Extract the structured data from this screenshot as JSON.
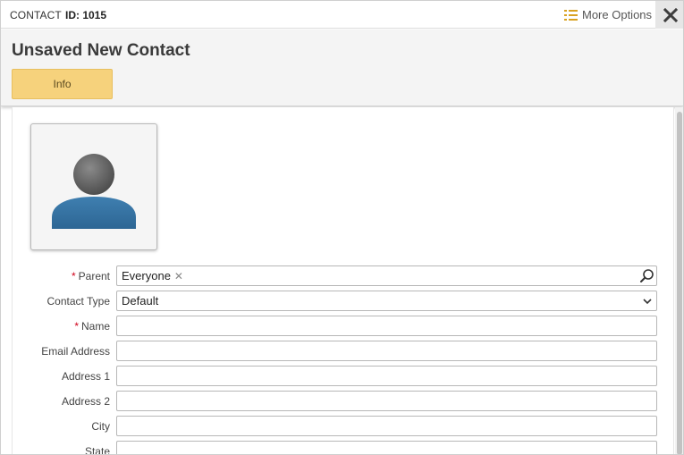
{
  "topbar": {
    "record_type": "CONTACT",
    "id_label": "ID: 1015",
    "more_options_label": "More Options",
    "accent_color": "#d9a221"
  },
  "header": {
    "title": "Unsaved New Contact",
    "tabs": [
      {
        "label": "Info",
        "active": true
      }
    ],
    "tab_color": "#f6d27c"
  },
  "form": {
    "parent": {
      "label": "Parent",
      "required": "*",
      "value": "Everyone"
    },
    "contact_type": {
      "label": "Contact Type",
      "value": "Default"
    },
    "name": {
      "label": "Name",
      "required": "*",
      "value": ""
    },
    "email": {
      "label": "Email Address",
      "value": ""
    },
    "address1": {
      "label": "Address 1",
      "value": ""
    },
    "address2": {
      "label": "Address 2",
      "value": ""
    },
    "city": {
      "label": "City",
      "value": ""
    },
    "state": {
      "label": "State",
      "value": ""
    }
  },
  "icons": {
    "list": "list-icon",
    "close": "close-icon",
    "avatar": "person-placeholder-icon",
    "search": "search-icon",
    "chevron": "chevron-down-icon",
    "remove": "remove-chip-icon"
  }
}
